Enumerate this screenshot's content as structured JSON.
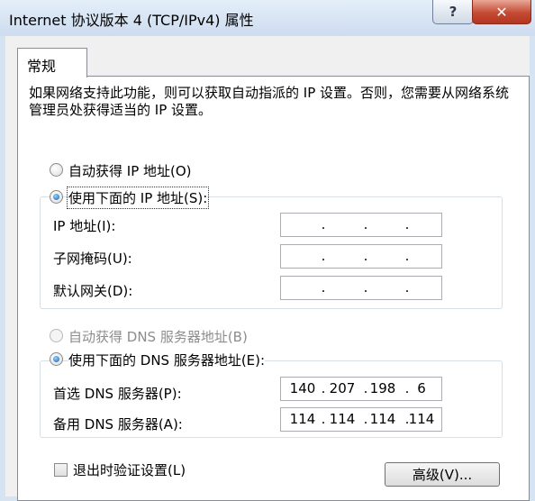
{
  "window": {
    "title": "Internet 协议版本 4 (TCP/IPv4) 属性",
    "help_label": "?",
    "close_label": "✕"
  },
  "tabs": [
    {
      "label": "常规",
      "selected": true
    }
  ],
  "description": "如果网络支持此功能，则可以获取自动指派的 IP 设置。否则，您需要从网络系统管理员处获得适当的 IP 设置。",
  "ip_section": {
    "auto_label": "自动获得 IP 地址(O)",
    "manual_label": "使用下面的 IP 地址(S):",
    "selected": "manual",
    "fields": [
      {
        "label": "IP 地址(I):",
        "octets": [
          "",
          "",
          "",
          ""
        ]
      },
      {
        "label": "子网掩码(U):",
        "octets": [
          "",
          "",
          "",
          ""
        ]
      },
      {
        "label": "默认网关(D):",
        "octets": [
          "",
          "",
          "",
          ""
        ]
      }
    ]
  },
  "dns_section": {
    "auto_label": "自动获得 DNS 服务器地址(B)",
    "auto_disabled": true,
    "manual_label": "使用下面的 DNS 服务器地址(E):",
    "selected": "manual",
    "fields": [
      {
        "label": "首选 DNS 服务器(P):",
        "octets": [
          "140",
          "207",
          "198",
          "6"
        ]
      },
      {
        "label": "备用 DNS 服务器(A):",
        "octets": [
          "114",
          "114",
          "114",
          "114"
        ]
      }
    ]
  },
  "validate_on_exit": {
    "label": "退出时验证设置(L)",
    "checked": false
  },
  "advanced_button": {
    "label": "高级(V)..."
  }
}
